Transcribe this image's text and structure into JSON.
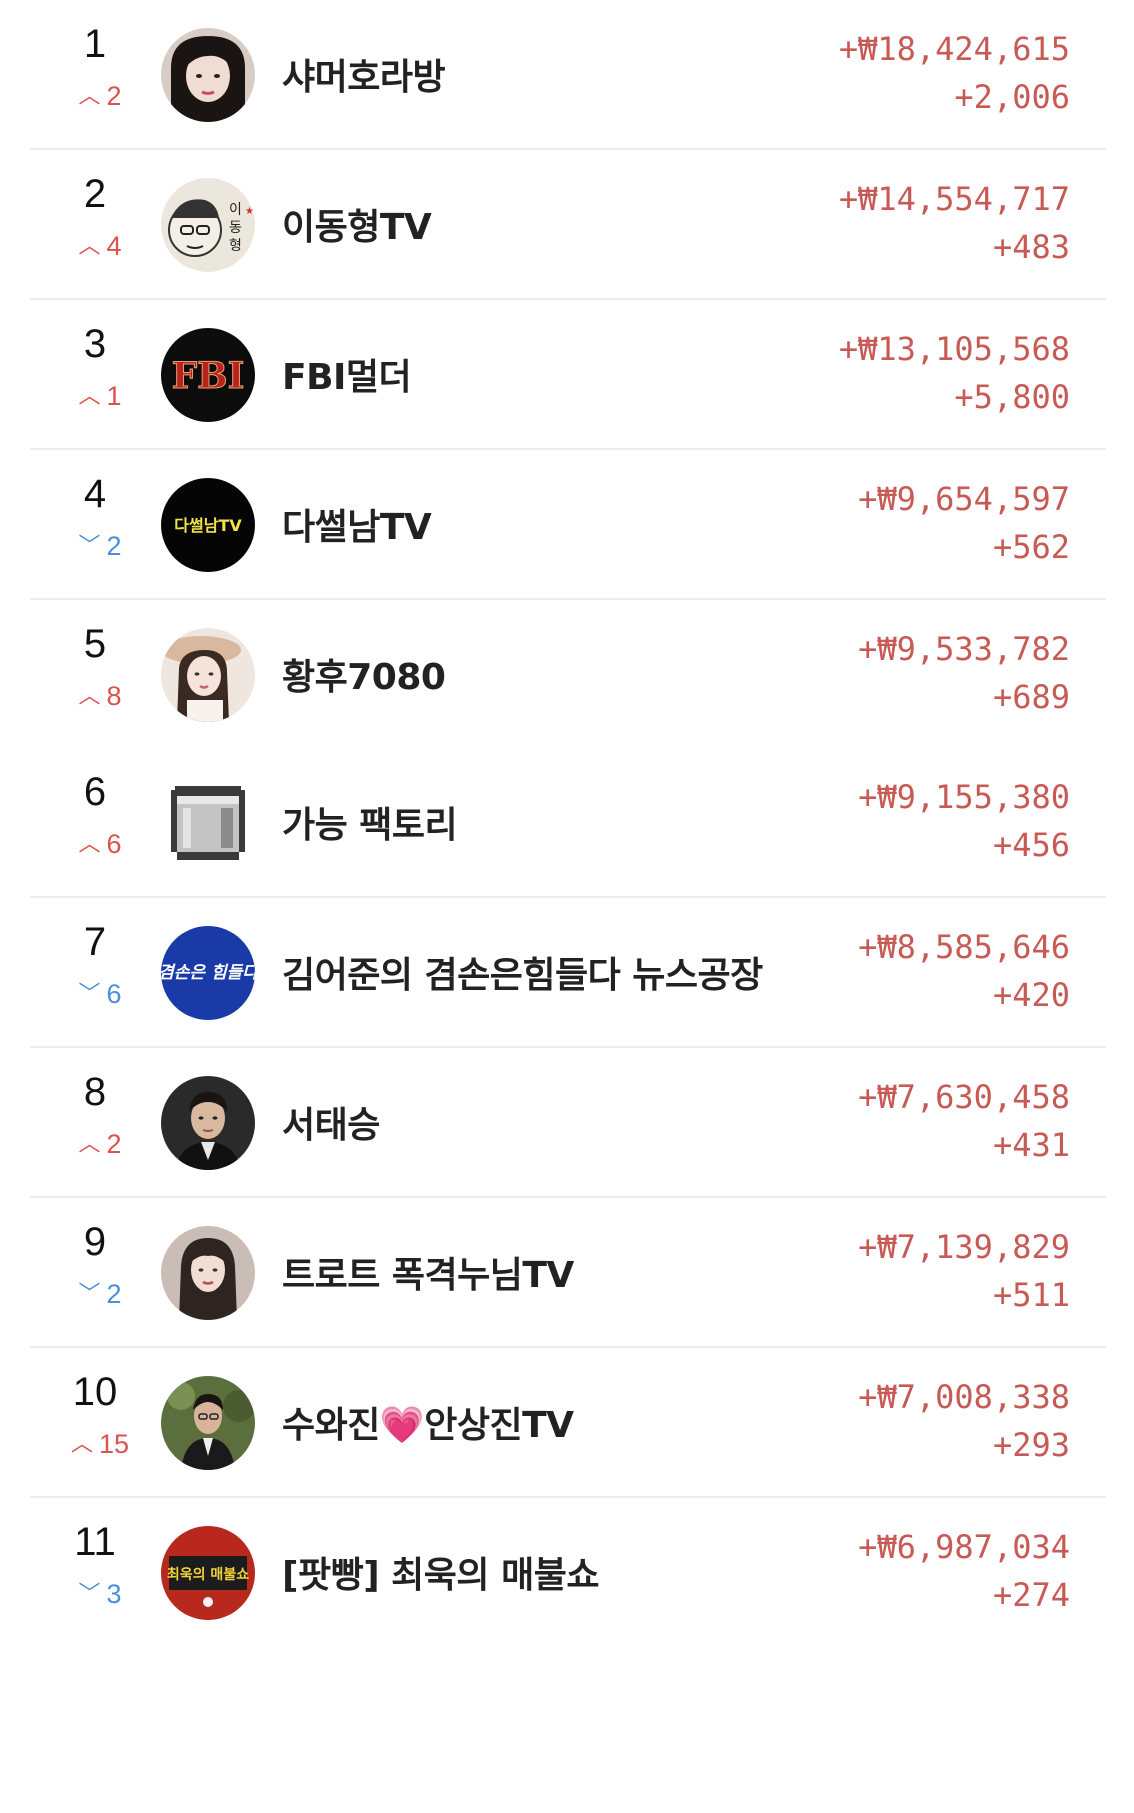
{
  "rankings": [
    {
      "rank": "1",
      "direction": "up",
      "change": "2",
      "name": "샤머호라방",
      "amount": "+₩18,424,615",
      "count": "+2,006",
      "avatar": "woman-portrait-avatar"
    },
    {
      "rank": "2",
      "direction": "up",
      "change": "4",
      "name": "이동형TV",
      "amount": "+₩14,554,717",
      "count": "+483",
      "avatar": "caricature-avatar"
    },
    {
      "rank": "3",
      "direction": "up",
      "change": "1",
      "name": "FBI멀더",
      "amount": "+₩13,105,568",
      "count": "+5,800",
      "avatar": "fbi-logo-avatar",
      "logo_text": "FBI"
    },
    {
      "rank": "4",
      "direction": "down",
      "change": "2",
      "name": "다썰남TV",
      "amount": "+₩9,654,597",
      "count": "+562",
      "avatar": "dasseolnam-logo-avatar",
      "logo_text": "다썰남TV"
    },
    {
      "rank": "5",
      "direction": "up",
      "change": "8",
      "name": "황후7080",
      "amount": "+₩9,533,782",
      "count": "+689",
      "avatar": "woman-hat-avatar"
    },
    {
      "rank": "6",
      "direction": "up",
      "change": "6",
      "name": "가능 팩토리",
      "amount": "+₩9,155,380",
      "count": "+456",
      "avatar": "pixel-bucket-avatar"
    },
    {
      "rank": "7",
      "direction": "down",
      "change": "6",
      "name": "김어준의 겸손은힘들다 뉴스공장",
      "amount": "+₩8,585,646",
      "count": "+420",
      "avatar": "news-factory-logo-avatar",
      "logo_text": "겸손은 힘들다"
    },
    {
      "rank": "8",
      "direction": "up",
      "change": "2",
      "name": "서태승",
      "amount": "+₩7,630,458",
      "count": "+431",
      "avatar": "man-portrait-avatar"
    },
    {
      "rank": "9",
      "direction": "down",
      "change": "2",
      "name": "트로트 폭격누님TV",
      "amount": "+₩7,139,829",
      "count": "+511",
      "avatar": "woman-longhair-avatar"
    },
    {
      "rank": "10",
      "direction": "up",
      "change": "15",
      "name_before": "수와진",
      "name_after": "안상진TV",
      "name_emoji": "💗",
      "amount": "+₩7,008,338",
      "count": "+293",
      "avatar": "man-suit-avatar"
    },
    {
      "rank": "11",
      "direction": "down",
      "change": "3",
      "name": "[팟빵] 최욱의 매불쇼",
      "amount": "+₩6,987,034",
      "count": "+274",
      "avatar": "maebulsho-logo-avatar",
      "logo_text": "최욱의 매불쇼"
    }
  ],
  "colors": {
    "up": "#d9534f",
    "down": "#4a90d9",
    "amount": "#c75a55",
    "divider": "#ececec"
  },
  "icons": {
    "up": "chevron-up-icon",
    "down": "chevron-down-icon"
  }
}
